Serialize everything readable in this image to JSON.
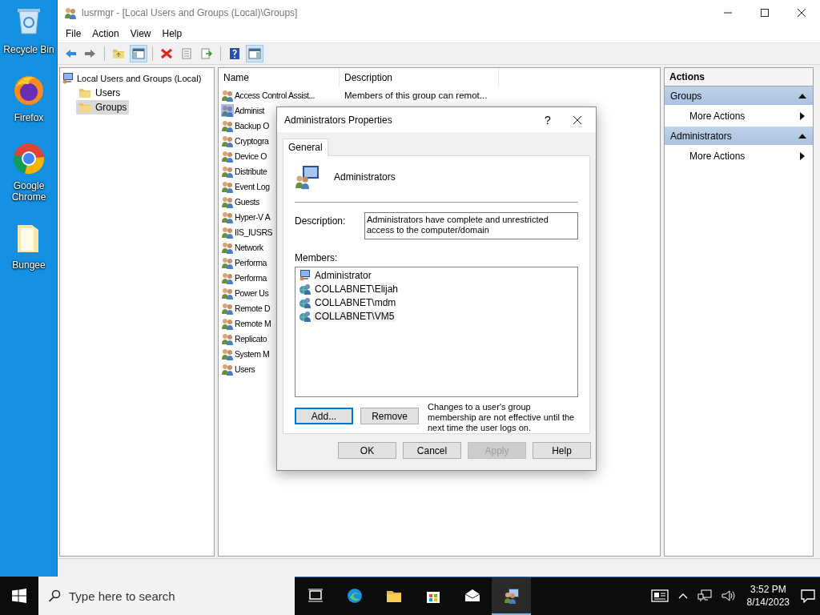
{
  "desktop_icons": [
    {
      "kind": "recycle",
      "label": "Recycle Bin"
    },
    {
      "kind": "firefox",
      "label": "Firefox"
    },
    {
      "kind": "chrome",
      "label": "Google Chrome"
    },
    {
      "kind": "folder",
      "label": "Bungee"
    }
  ],
  "window": {
    "title": "lusrmgr - [Local Users and Groups (Local)\\Groups]",
    "menu": [
      "File",
      "Action",
      "View",
      "Help"
    ],
    "tree": {
      "label": "Local Users and Groups (Local)",
      "children": [
        {
          "label": "Users",
          "selected": false
        },
        {
          "label": "Groups",
          "selected": true
        }
      ]
    },
    "list": {
      "columns": [
        "Name",
        "Description"
      ],
      "rows": [
        {
          "name": "Access Control Assist...",
          "description": "Members of this group can remot...",
          "selected": false
        },
        {
          "name": "Administ",
          "selected": true
        },
        {
          "name": "Backup O",
          "selected": false
        },
        {
          "name": "Cryptogra",
          "selected": false
        },
        {
          "name": "Device O",
          "selected": false
        },
        {
          "name": "Distribute",
          "selected": false
        },
        {
          "name": "Event Log",
          "selected": false
        },
        {
          "name": "Guests",
          "selected": false
        },
        {
          "name": "Hyper-V A",
          "selected": false
        },
        {
          "name": "IIS_IUSRS",
          "selected": false
        },
        {
          "name": "Network",
          "selected": false
        },
        {
          "name": "Performa",
          "selected": false
        },
        {
          "name": "Performa",
          "selected": false
        },
        {
          "name": "Power Us",
          "selected": false
        },
        {
          "name": "Remote D",
          "selected": false
        },
        {
          "name": "Remote M",
          "selected": false
        },
        {
          "name": "Replicato",
          "selected": false
        },
        {
          "name": "System M",
          "selected": false
        },
        {
          "name": "Users",
          "selected": false
        }
      ]
    },
    "actions": {
      "title": "Actions",
      "sections": [
        {
          "title": "Groups",
          "items": [
            "More Actions"
          ]
        },
        {
          "title": "Administrators",
          "items": [
            "More Actions"
          ]
        }
      ]
    }
  },
  "dialog": {
    "title": "Administrators Properties",
    "help": "?",
    "tabs": [
      {
        "label": "General",
        "selected": true
      }
    ],
    "group_name": "Administrators",
    "description_label": "Description:",
    "description": "Administrators have complete and unrestricted access to the computer/domain",
    "members_label": "Members:",
    "members": [
      {
        "kind": "local",
        "name": "Administrator",
        "selected": false
      },
      {
        "kind": "domain",
        "name": "COLLABNET\\Elijah",
        "selected": false
      },
      {
        "kind": "domain",
        "name": "COLLABNET\\mdm",
        "selected": false
      },
      {
        "kind": "domain",
        "name": "COLLABNET\\VM5",
        "selected": true
      }
    ],
    "member_buttons": [
      {
        "label": "Add...",
        "default": true
      },
      {
        "label": "Remove",
        "default": false
      }
    ],
    "note": "Changes to a user's group membership are not effective until the next time the user logs on.",
    "buttons": [
      {
        "label": "OK",
        "disabled": false
      },
      {
        "label": "Cancel",
        "disabled": false
      },
      {
        "label": "Apply",
        "disabled": true
      },
      {
        "label": "Help",
        "disabled": false
      }
    ]
  },
  "taskbar": {
    "search_placeholder": "Type here to search",
    "time": "3:52 PM",
    "date": "8/14/2023"
  }
}
